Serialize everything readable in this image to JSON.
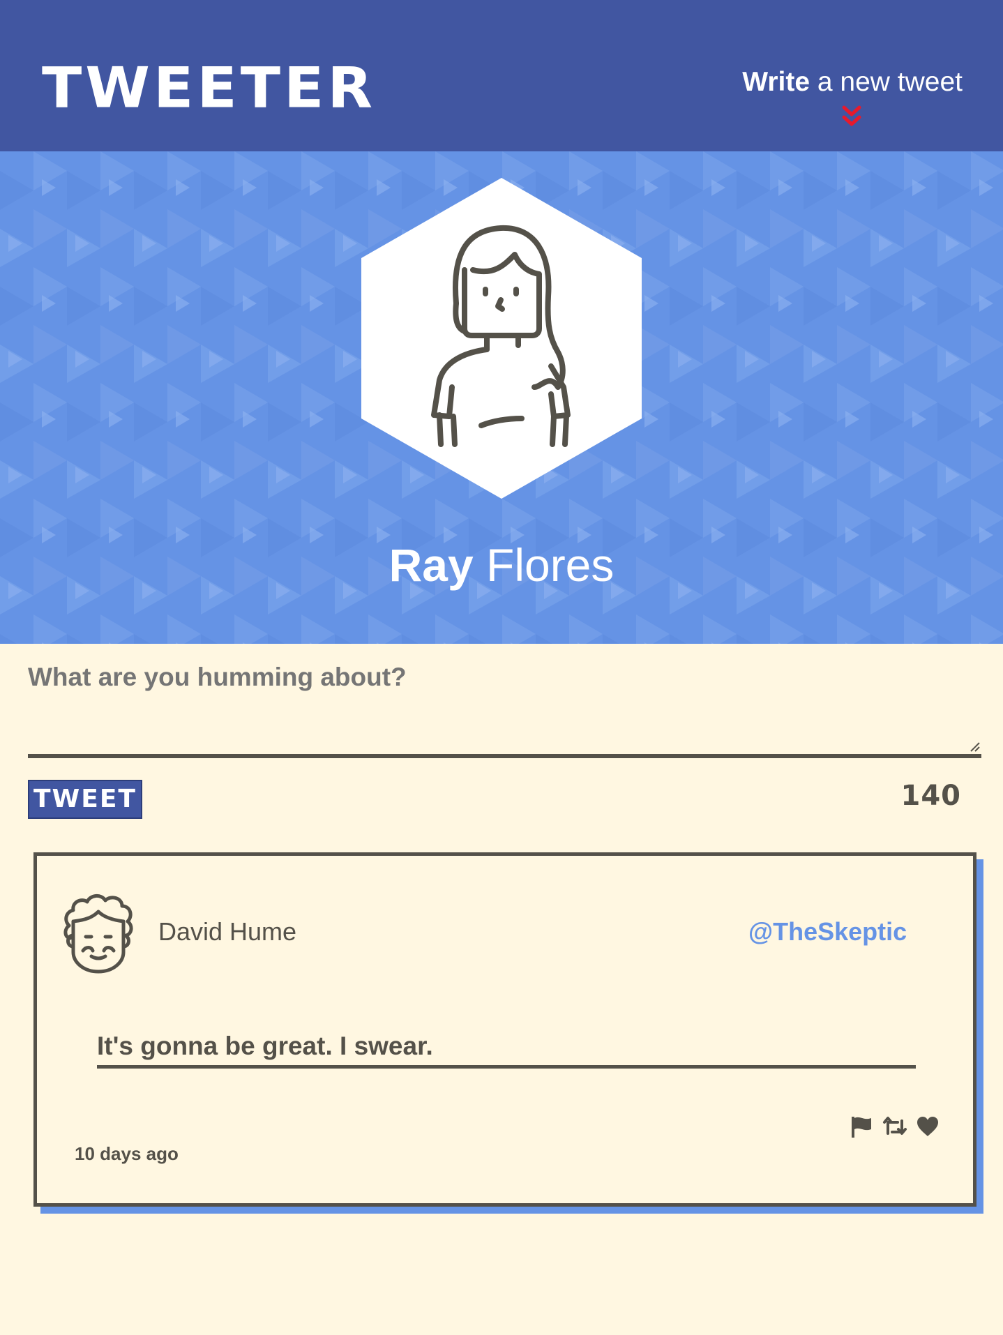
{
  "nav": {
    "brand": "TWEETER",
    "compose_bold": "Write",
    "compose_rest": " a new tweet",
    "arrow_icon": "double-chevron-down-icon",
    "arrow_color": "#e8192c"
  },
  "profile": {
    "first_name": "Ray",
    "last_name": " Flores",
    "avatar_icon": "woman-avatar-icon"
  },
  "composer": {
    "prompt": "What are you humming about?",
    "button_label": "TWEET",
    "char_count": "140"
  },
  "tweets": [
    {
      "author": "David Hume",
      "handle": "@TheSkeptic",
      "text": "It's gonna be great. I swear.",
      "time": "10 days ago",
      "avatar_icon": "man-avatar-icon",
      "actions": [
        "flag-icon",
        "retweet-icon",
        "heart-icon"
      ]
    }
  ],
  "colors": {
    "nav": "#4156a1",
    "hero": "#6593e5",
    "background": "#fff7e1",
    "text": "#545149"
  }
}
